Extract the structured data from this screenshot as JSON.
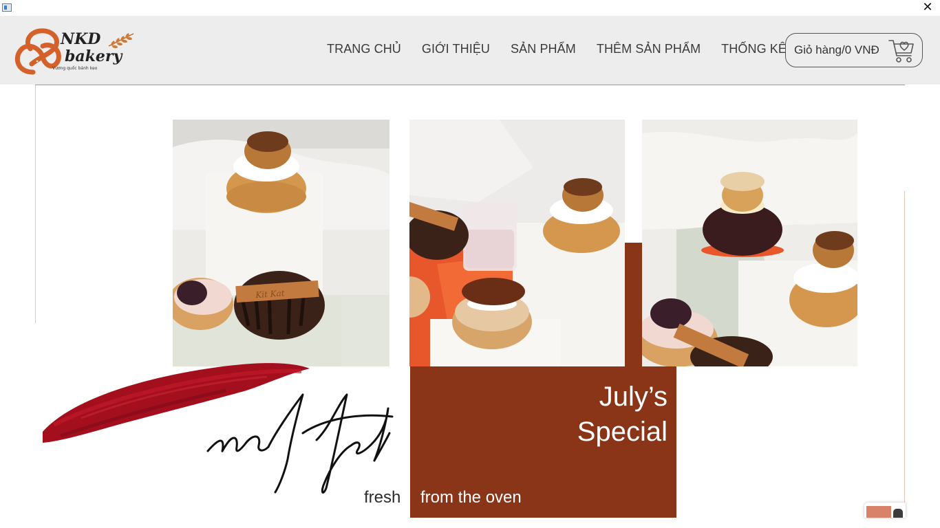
{
  "window": {
    "close_glyph": "✕"
  },
  "logo": {
    "name_line1": "NKD",
    "name_line2": "bakery",
    "tagline": "Vương quốc bánh kẹo"
  },
  "nav": {
    "items": [
      {
        "label": "TRANG CHỦ"
      },
      {
        "label": "GIỚI THIỆU"
      },
      {
        "label": "SẢN PHẨM"
      },
      {
        "label": "THÊM SẢN PHẨM"
      },
      {
        "label": "THỐNG KÊ"
      }
    ]
  },
  "cart": {
    "label": "Giỏ hàng/0 VNĐ",
    "icon": "cart-icon"
  },
  "banner": {
    "special_line1": "July’s",
    "special_line2": "Special",
    "script_word": "matted",
    "fresh": "fresh",
    "from_the_oven": "from the oven"
  },
  "colors": {
    "header_bg": "#ededed",
    "accent_rust": "#8b3518",
    "brush_red": "#a40f1e",
    "logo_orange": "#d4612a"
  }
}
